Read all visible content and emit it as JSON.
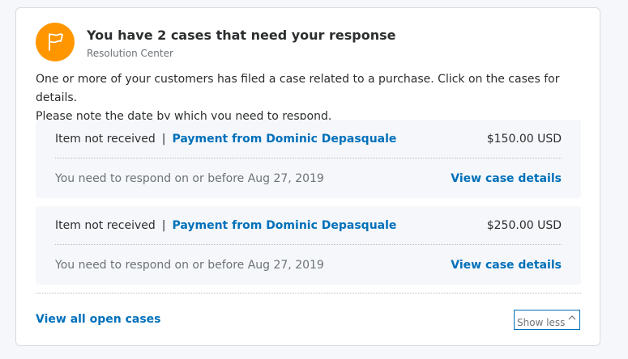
{
  "header": {
    "icon": "flag-icon",
    "icon_color": "#ff9600",
    "title": "You have 2 cases that need your response",
    "subtitle": "Resolution Center"
  },
  "intro": {
    "line1": "One or more of your customers has filed a case related to a purchase. Click on the cases for details.",
    "line2": "Please note the date by which you need to respond."
  },
  "cases": [
    {
      "type": "Item not received",
      "separator": "|",
      "payment": "Payment from Dominic Depasquale",
      "amount": "$150.00 USD",
      "deadline": "You need to respond on or before Aug 27, 2019",
      "link": "View case details"
    },
    {
      "type": "Item not received",
      "separator": "|",
      "payment": "Payment from Dominic Depasquale",
      "amount": "$250.00 USD",
      "deadline": "You need to respond on or before Aug 27, 2019",
      "link": "View case details"
    }
  ],
  "footer": {
    "all_cases_link": "View all open cases",
    "toggle_label": "Show less",
    "toggle_icon": "chevron-up-icon"
  },
  "colors": {
    "link": "#0070ba",
    "card_bg": "#ffffff",
    "case_bg": "#f5f7fa"
  }
}
